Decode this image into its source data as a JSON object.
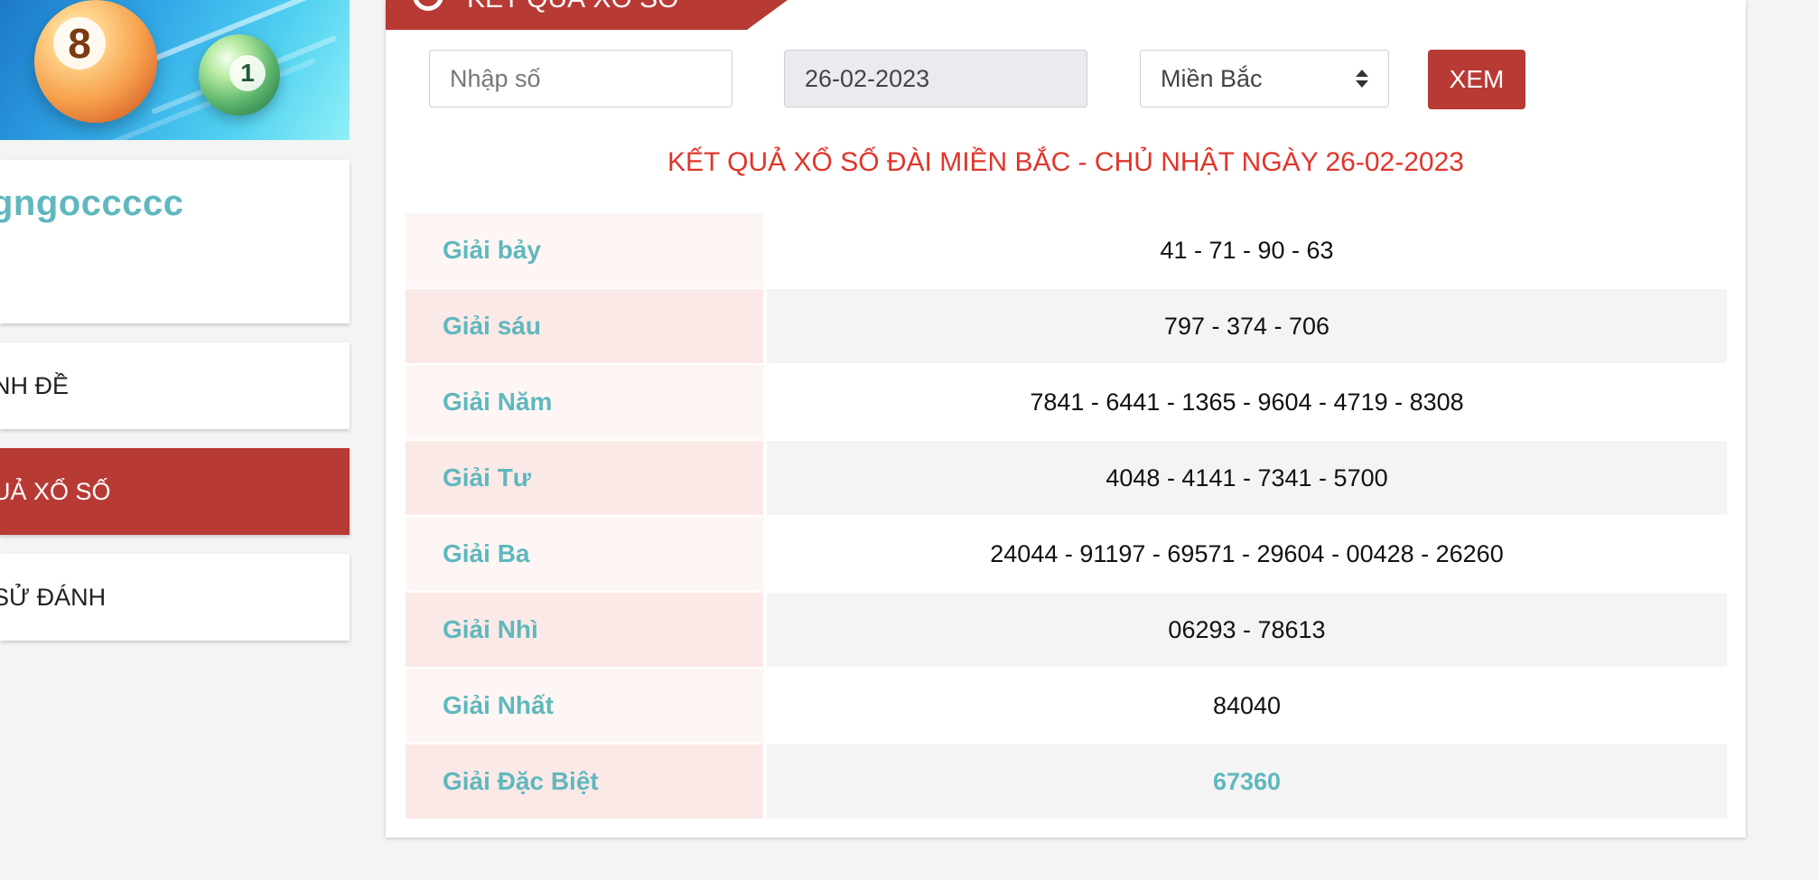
{
  "sidebar": {
    "username": "gngoccccc",
    "menu": [
      {
        "label": "NH ĐỀ",
        "active": false
      },
      {
        "label": "UẢ XỔ SỐ",
        "active": true
      },
      {
        "label": "SỬ ĐÁNH",
        "active": false
      }
    ],
    "banner": {
      "ball_orange_number": "8",
      "ball_green_number": "1"
    }
  },
  "panel": {
    "header_title": "KẾT QUẢ XỔ SỐ",
    "search_placeholder": "Nhập số",
    "date_value": "26-02-2023",
    "region_selected": "Miền Bắc",
    "view_button": "XEM",
    "result_title": "KẾT QUẢ XỔ SỐ ĐÀI MIỀN BẮC - CHỦ NHẬT NGÀY 26-02-2023",
    "results": [
      {
        "prize": "Giải bảy",
        "numbers": "41 - 71 - 90 - 63"
      },
      {
        "prize": "Giải sáu",
        "numbers": "797 - 374 - 706"
      },
      {
        "prize": "Giải Năm",
        "numbers": "7841 - 6441 - 1365 - 9604 - 4719 - 8308"
      },
      {
        "prize": "Giải Tư",
        "numbers": "4048 - 4141 - 7341 - 5700"
      },
      {
        "prize": "Giải Ba",
        "numbers": "24044 - 91197 - 69571 - 29604 - 00428 - 26260"
      },
      {
        "prize": "Giải Nhì",
        "numbers": "06293 - 78613"
      },
      {
        "prize": "Giải Nhất",
        "numbers": "84040"
      },
      {
        "prize": "Giải Đặc Biệt",
        "numbers": "67360"
      }
    ]
  },
  "colors": {
    "brand_red": "#b83a34",
    "title_red": "#e0352b",
    "teal": "#5fb8bd",
    "page_bg": "#f4f4f4"
  }
}
